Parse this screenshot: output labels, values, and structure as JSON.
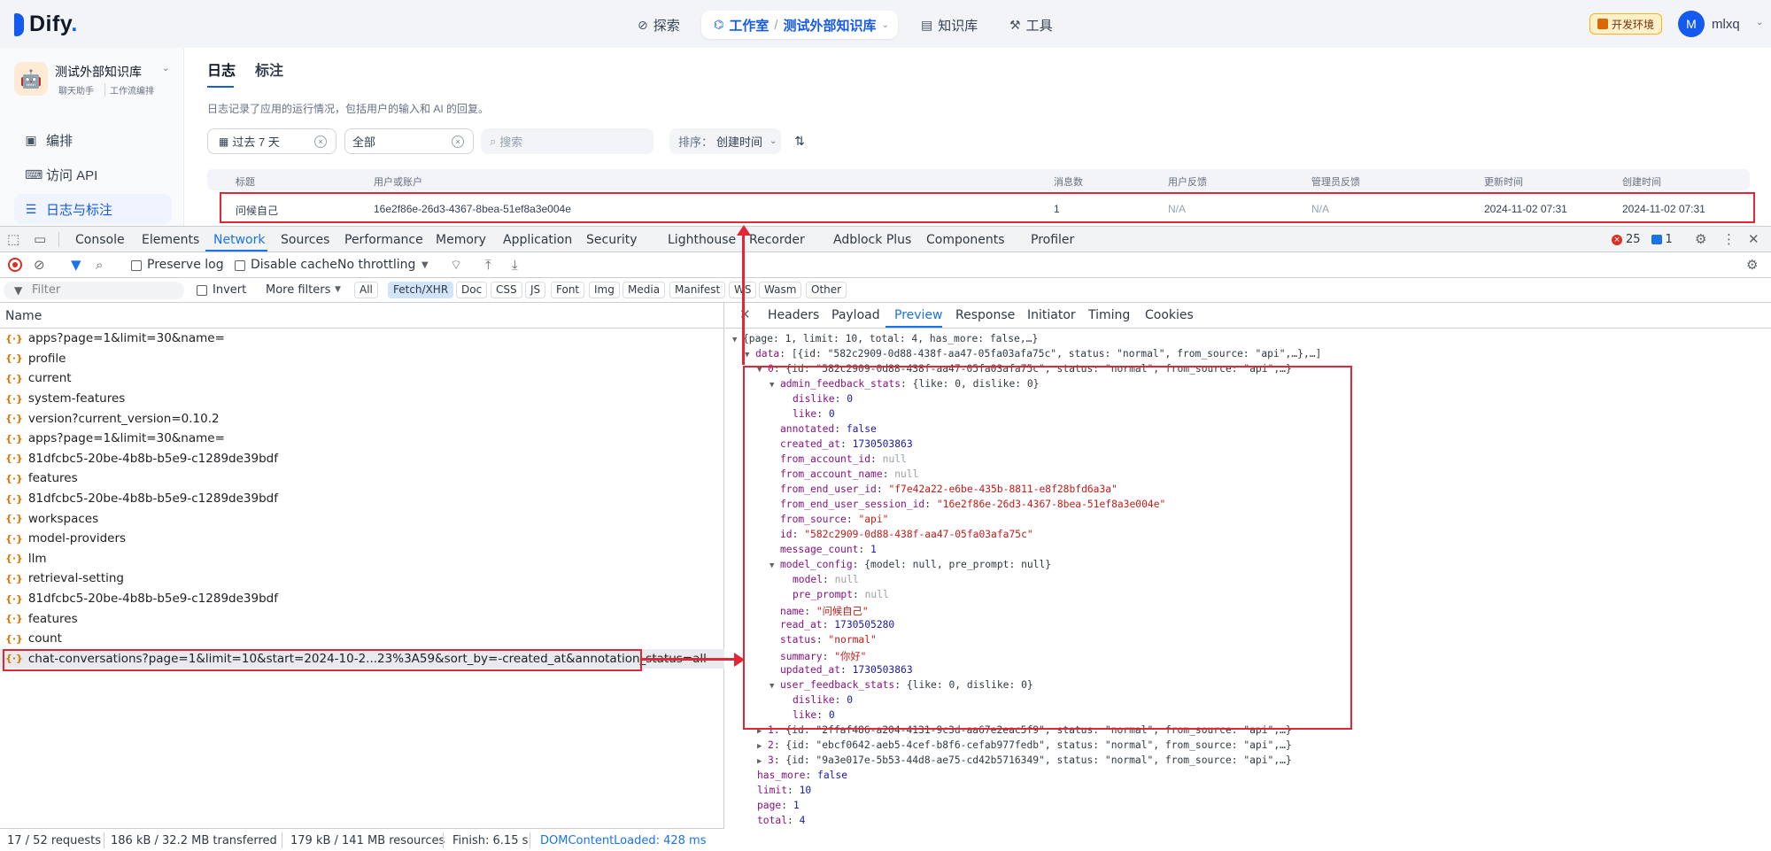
{
  "topbar": {
    "logo": "Dify",
    "nav": [
      {
        "label": "探索",
        "icon": "compass-icon"
      },
      {
        "label": "知识库",
        "icon": "book-icon"
      },
      {
        "label": "工具",
        "icon": "wrench-icon"
      }
    ],
    "studio": {
      "label": "工作室",
      "app": "测试外部知识库"
    },
    "env_badge": "开发环境",
    "avatar_initial": "M",
    "username": "mlxq"
  },
  "sidebar": {
    "app_name": "测试外部知识库",
    "tags": [
      "聊天助手",
      "工作流编排"
    ],
    "items": [
      {
        "label": "编排",
        "icon": "layout-icon"
      },
      {
        "label": "访问 API",
        "icon": "terminal-icon"
      },
      {
        "label": "日志与标注",
        "icon": "file-text-icon"
      }
    ]
  },
  "main": {
    "tabs": [
      "日志",
      "标注"
    ],
    "description": "日志记录了应用的运行情况，包括用户的输入和 AI 的回复。",
    "filters": {
      "date": "过去 7 天",
      "status": "全部",
      "search_placeholder": "搜索",
      "sort_label": "排序：",
      "sort_value": "创建时间"
    },
    "table": {
      "headers": [
        "标题",
        "用户或账户",
        "消息数",
        "用户反馈",
        "管理员反馈",
        "更新时间",
        "创建时间"
      ],
      "rows": [
        [
          "问候自己",
          "16e2f86e-26d3-4367-8bea-51ef8a3e004e",
          "1",
          "N/A",
          "N/A",
          "2024-11-02 07:31",
          "2024-11-02 07:31"
        ]
      ]
    }
  },
  "devtools": {
    "tabs": [
      "Console",
      "Elements",
      "Network",
      "Sources",
      "Performance",
      "Memory",
      "Application",
      "Security",
      "Lighthouse",
      "Recorder",
      "Adblock Plus",
      "Components",
      "Profiler"
    ],
    "active_tab": "Network",
    "error_count": "25",
    "message_count": "1",
    "toolbar": {
      "preserve_log": "Preserve log",
      "disable_cache": "Disable cache",
      "throttling": "No throttling"
    },
    "filterbar": {
      "placeholder": "Filter",
      "invert": "Invert",
      "more_filters": "More filters",
      "chips": [
        "All",
        "Fetch/XHR",
        "Doc",
        "CSS",
        "JS",
        "Font",
        "Img",
        "Media",
        "Manifest",
        "WS",
        "Wasm",
        "Other"
      ],
      "active_chip": "Fetch/XHR"
    },
    "requests_header": "Name",
    "requests": [
      "apps?page=1&limit=30&name=",
      "profile",
      "current",
      "system-features",
      "version?current_version=0.10.2",
      "apps?page=1&limit=30&name=",
      "81dfcbc5-20be-4b8b-b5e9-c1289de39bdf",
      "features",
      "81dfcbc5-20be-4b8b-b5e9-c1289de39bdf",
      "workspaces",
      "model-providers",
      "llm",
      "retrieval-setting",
      "81dfcbc5-20be-4b8b-b5e9-c1289de39bdf",
      "features",
      "count",
      "chat-conversations?page=1&limit=10&start=2024-10-2...23%3A59&sort_by=-created_at&annotation_status=all"
    ],
    "status_bar": [
      "17 / 52 requests",
      "186 kB / 32.2 MB transferred",
      "179 kB / 141 MB resources",
      "Finish: 6.15 s",
      "DOMContentLoaded: 428 ms"
    ],
    "preview_tabs": [
      "Headers",
      "Payload",
      "Preview",
      "Response",
      "Initiator",
      "Timing",
      "Cookies"
    ],
    "active_preview_tab": "Preview"
  },
  "json_preview": {
    "root": "{page: 1, limit: 10, total: 4, has_more: false,…}",
    "data_summary": "[{id: \"582c2909-0d88-438f-aa47-05fa03afa75c\", status: \"normal\", from_source: \"api\",…},…]",
    "item0_summary": "{id: \"582c2909-0d88-438f-aa47-05fa03afa75c\", status: \"normal\", from_source: \"api\",…}",
    "admin_feedback_summary": "{like: 0, dislike: 0}",
    "dislike": "0",
    "like": "0",
    "annotated": "false",
    "created_at": "1730503863",
    "from_account_id": "null",
    "from_account_name": "null",
    "from_end_user_id": "\"f7e42a22-e6be-435b-8811-e8f28bfd6a3a\"",
    "from_end_user_session_id": "\"16e2f86e-26d3-4367-8bea-51ef8a3e004e\"",
    "from_source": "\"api\"",
    "id": "\"582c2909-0d88-438f-aa47-05fa03afa75c\"",
    "message_count": "1",
    "model_config_summary": "{model: null, pre_prompt: null}",
    "model": "null",
    "pre_prompt": "null",
    "name": "\"问候自己\"",
    "read_at": "1730505280",
    "status": "\"normal\"",
    "summary": "\"你好\"",
    "updated_at": "1730503863",
    "user_feedback_summary": "{like: 0, dislike: 0}",
    "uf_dislike": "0",
    "uf_like": "0",
    "item1": "{id: \"2ffaf486-a204-4131-9c3d-aa67e2eac5f9\", status: \"normal\", from_source: \"api\",…}",
    "item2": "{id: \"ebcf0642-aeb5-4cef-b8f6-cefab977fedb\", status: \"normal\", from_source: \"api\",…}",
    "item3": "{id: \"9a3e017e-5b53-44d8-ae75-cd42b5716349\", status: \"normal\", from_source: \"api\",…}",
    "has_more": "false",
    "limit": "10",
    "page": "1",
    "total": "4"
  }
}
